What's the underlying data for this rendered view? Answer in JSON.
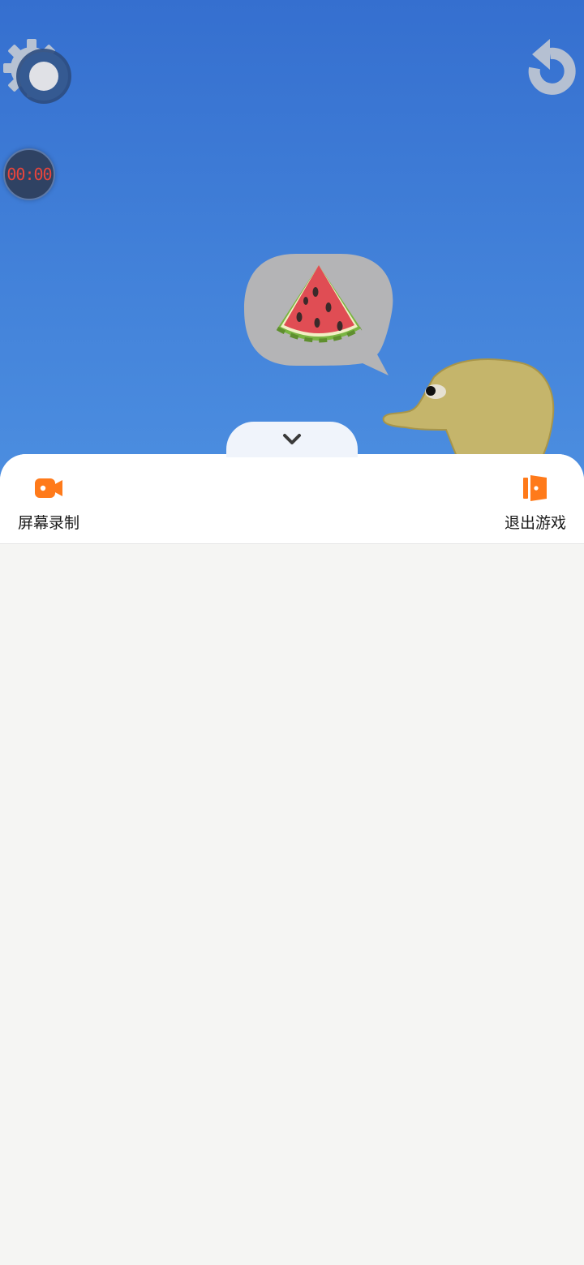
{
  "game": {
    "timer": "00:00",
    "controls": {
      "settings_icon": "gear-icon",
      "restart_icon": "restart-arrow-icon"
    },
    "scene": {
      "speech_bubble_item": "watermelon",
      "character": "duck"
    }
  },
  "panel": {
    "collapse_icon": "chevron-down-icon",
    "actions": [
      {
        "label": "屏幕录制",
        "icon": "video-camera-icon"
      },
      {
        "label": "退出游戏",
        "icon": "exit-door-icon"
      }
    ]
  },
  "colors": {
    "sky_top": "#356fcf",
    "sky_bottom": "#4c8ee0",
    "accent": "#ff7a1a",
    "timer_text": "#e8453c",
    "panel_background": "#f5f5f3"
  }
}
